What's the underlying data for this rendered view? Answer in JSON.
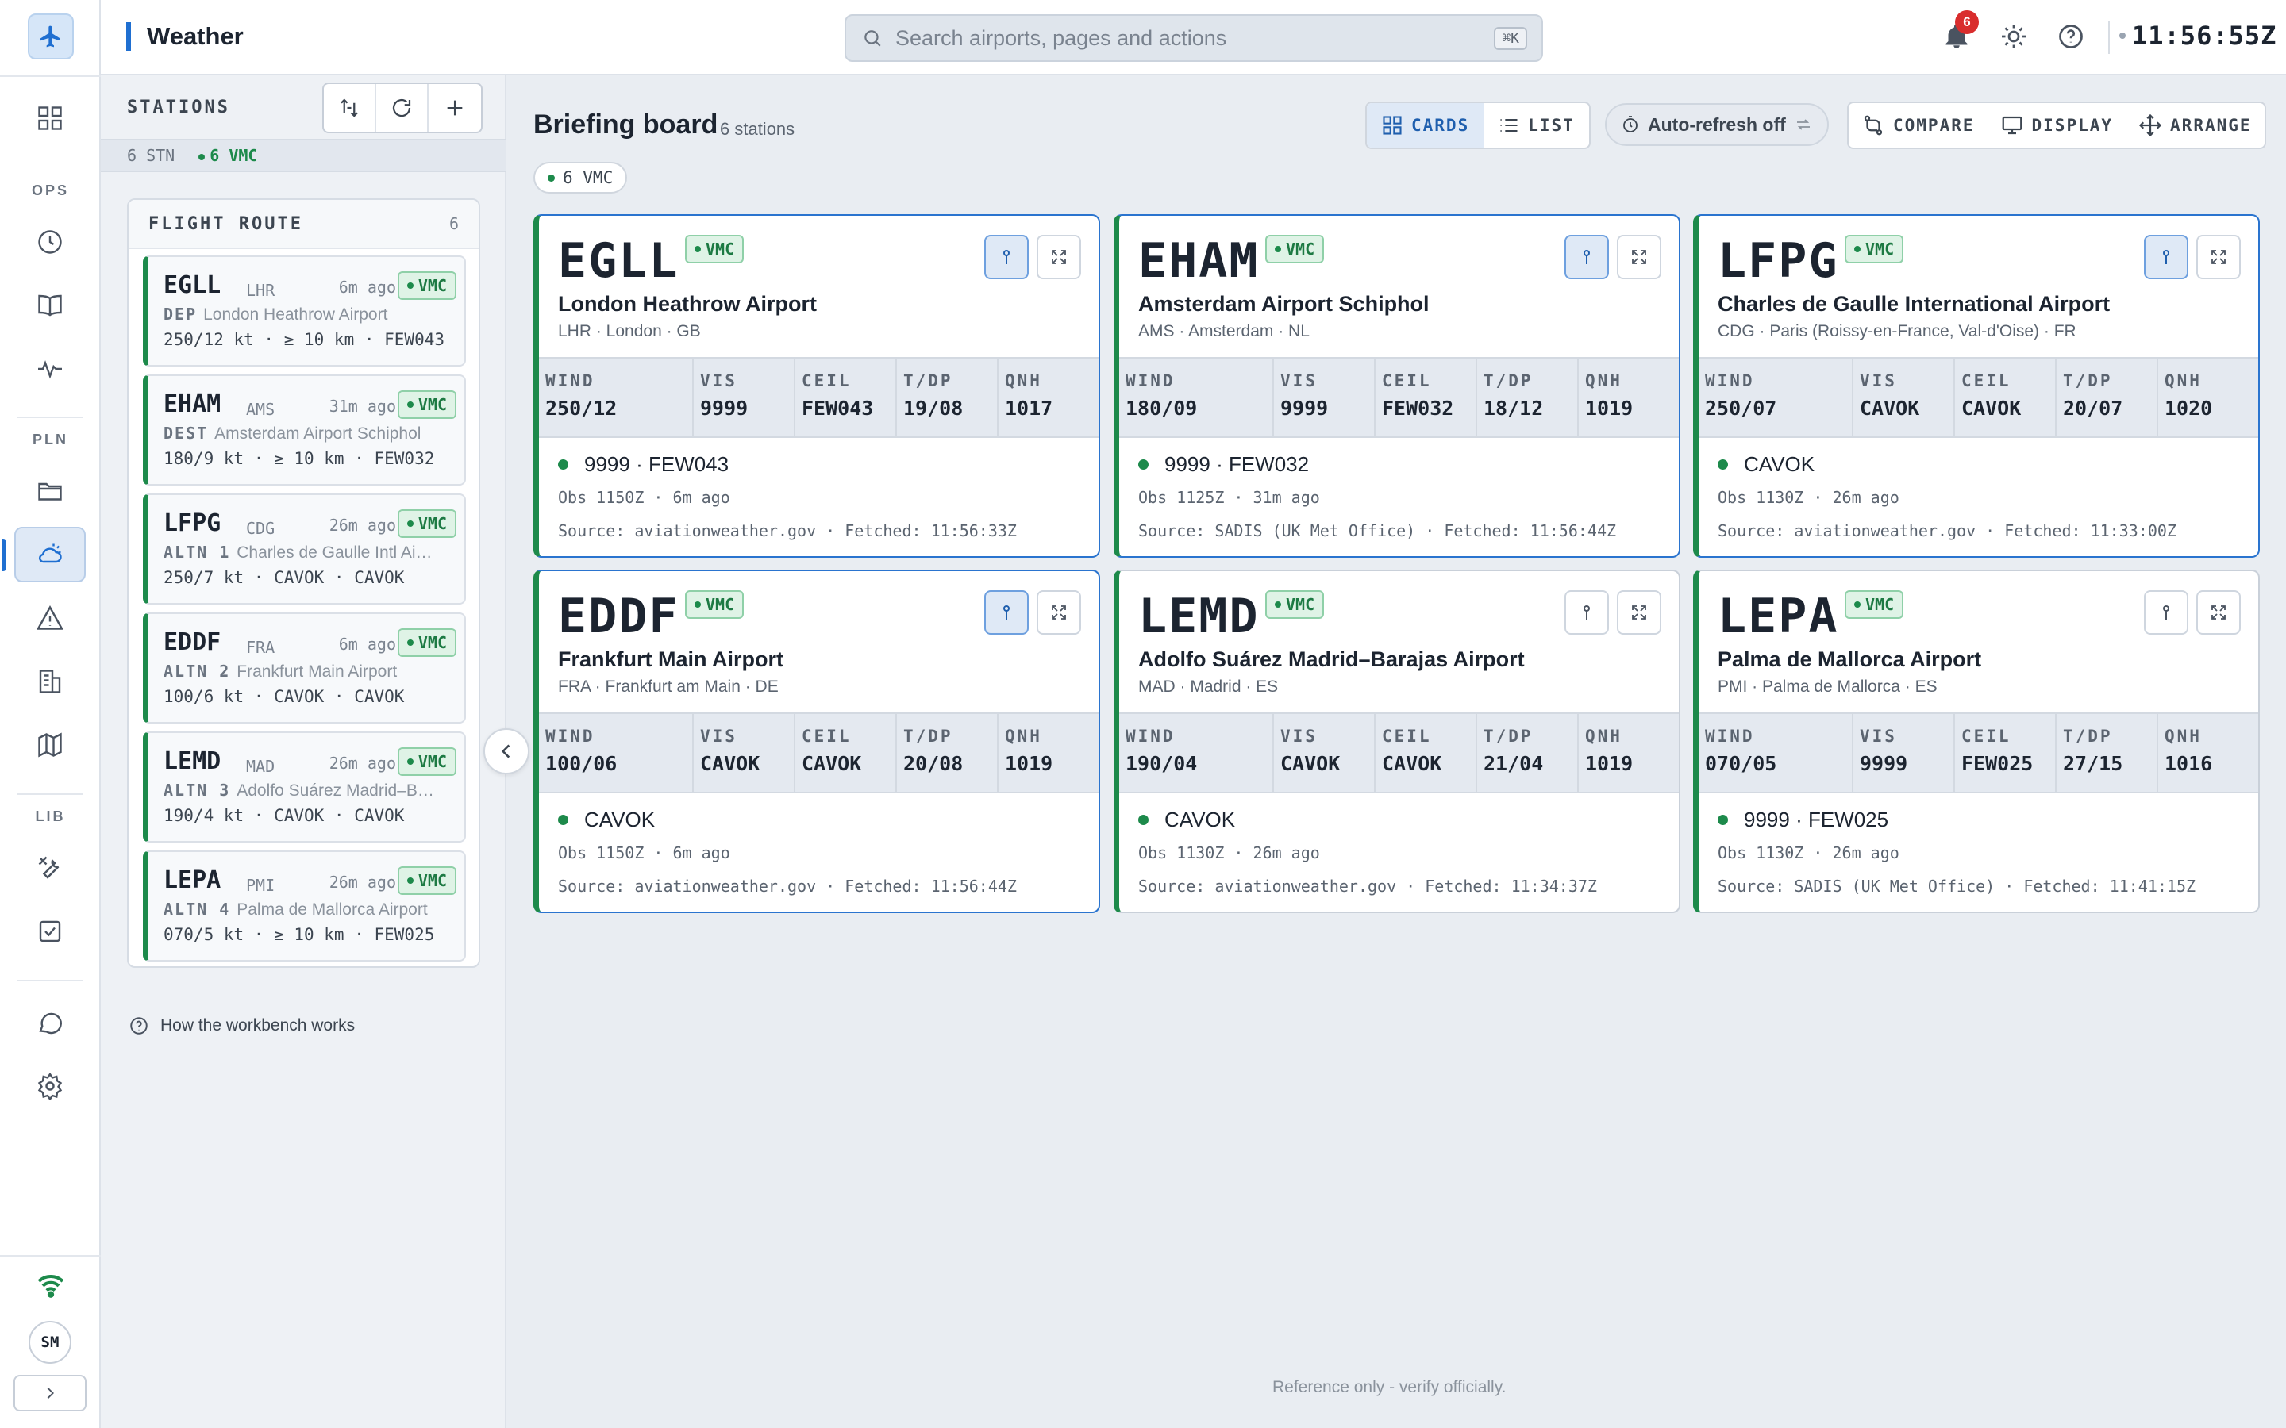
{
  "app": {
    "title": "Weather"
  },
  "search": {
    "placeholder": "Search airports, pages and actions",
    "shortcut": "⌘K"
  },
  "notifications": {
    "count": "6"
  },
  "clock": "11:56:55Z",
  "rail": {
    "sections": [
      "OPS",
      "PLN",
      "LIB"
    ],
    "items": [
      {
        "icon": "dashboard-icon"
      },
      {
        "icon": "clock-icon"
      },
      {
        "icon": "book-icon"
      },
      {
        "icon": "activity-icon"
      },
      {
        "icon": "folder-icon"
      },
      {
        "icon": "weather-icon"
      },
      {
        "icon": "warning-icon"
      },
      {
        "icon": "building-icon"
      },
      {
        "icon": "map-icon"
      },
      {
        "icon": "tools-icon"
      },
      {
        "icon": "checklist-icon"
      },
      {
        "icon": "chat-icon"
      },
      {
        "icon": "settings-icon"
      }
    ],
    "user_initials": "SM"
  },
  "stations_panel": {
    "title": "STATIONS",
    "stat_count": "6 STN",
    "stat_vmc": "6 VMC",
    "route_title": "FLIGHT ROUTE",
    "route_count": "6",
    "items": [
      {
        "icao": "EGLL",
        "iata": "LHR",
        "ago": "6m ago",
        "badge": "VMC",
        "role": "DEP",
        "name": "London Heathrow Airport",
        "wx": "250/12 kt · ≥ 10 km · FEW043"
      },
      {
        "icao": "EHAM",
        "iata": "AMS",
        "ago": "31m ago",
        "badge": "VMC",
        "role": "DEST",
        "name": "Amsterdam Airport Schiphol",
        "wx": "180/9 kt · ≥ 10 km · FEW032"
      },
      {
        "icao": "LFPG",
        "iata": "CDG",
        "ago": "26m ago",
        "badge": "VMC",
        "role": "ALTN 1",
        "name": "Charles de Gaulle Intl Ai…",
        "wx": "250/7 kt · CAVOK · CAVOK"
      },
      {
        "icao": "EDDF",
        "iata": "FRA",
        "ago": "6m ago",
        "badge": "VMC",
        "role": "ALTN 2",
        "name": "Frankfurt Main Airport",
        "wx": "100/6 kt · CAVOK · CAVOK"
      },
      {
        "icao": "LEMD",
        "iata": "MAD",
        "ago": "26m ago",
        "badge": "VMC",
        "role": "ALTN 3",
        "name": "Adolfo Suárez Madrid–B…",
        "wx": "190/4 kt · CAVOK · CAVOK"
      },
      {
        "icao": "LEPA",
        "iata": "PMI",
        "ago": "26m ago",
        "badge": "VMC",
        "role": "ALTN 4",
        "name": "Palma de Mallorca Airport",
        "wx": "070/5 kt · ≥ 10 km · FEW025"
      }
    ],
    "help_link": "How the workbench works"
  },
  "main": {
    "title": "Briefing board",
    "subtitle": "6 stations",
    "chip": "6 VMC",
    "view_cards": "CARDS",
    "view_list": "LIST",
    "auto_refresh": "Auto-refresh off",
    "compare": "COMPARE",
    "display": "DISPLAY",
    "arrange": "ARRANGE",
    "labels": {
      "wind": "WIND",
      "vis": "VIS",
      "ceil": "CEIL",
      "tdp": "T/DP",
      "qnh": "QNH"
    },
    "footer": "Reference only - verify officially."
  },
  "cards": [
    {
      "icao": "EGLL",
      "badge": "VMC",
      "name": "London Heathrow Airport",
      "sub": "LHR · London · GB",
      "wind": "250/12",
      "vis": "9999",
      "ceil": "FEW043",
      "tdp": "19/08",
      "qnh": "1017",
      "wx": "9999 · FEW043",
      "obs": "Obs 1150Z · 6m ago",
      "src": "Source: aviationweather.gov · Fetched: 11:56:33Z",
      "pinned": true
    },
    {
      "icao": "EHAM",
      "badge": "VMC",
      "name": "Amsterdam Airport Schiphol",
      "sub": "AMS · Amsterdam · NL",
      "wind": "180/09",
      "vis": "9999",
      "ceil": "FEW032",
      "tdp": "18/12",
      "qnh": "1019",
      "wx": "9999 · FEW032",
      "obs": "Obs 1125Z · 31m ago",
      "src": "Source: SADIS (UK Met Office) · Fetched: 11:56:44Z",
      "pinned": true
    },
    {
      "icao": "LFPG",
      "badge": "VMC",
      "name": "Charles de Gaulle International Airport",
      "sub": "CDG · Paris (Roissy-en-France, Val-d'Oise) · FR",
      "wind": "250/07",
      "vis": "CAVOK",
      "ceil": "CAVOK",
      "tdp": "20/07",
      "qnh": "1020",
      "wx": "CAVOK",
      "obs": "Obs 1130Z · 26m ago",
      "src": "Source: aviationweather.gov · Fetched: 11:33:00Z",
      "pinned": true
    },
    {
      "icao": "EDDF",
      "badge": "VMC",
      "name": "Frankfurt Main Airport",
      "sub": "FRA · Frankfurt am Main · DE",
      "wind": "100/06",
      "vis": "CAVOK",
      "ceil": "CAVOK",
      "tdp": "20/08",
      "qnh": "1019",
      "wx": "CAVOK",
      "obs": "Obs 1150Z · 6m ago",
      "src": "Source: aviationweather.gov · Fetched: 11:56:44Z",
      "pinned": true
    },
    {
      "icao": "LEMD",
      "badge": "VMC",
      "name": "Adolfo Suárez Madrid–Barajas Airport",
      "sub": "MAD · Madrid · ES",
      "wind": "190/04",
      "vis": "CAVOK",
      "ceil": "CAVOK",
      "tdp": "21/04",
      "qnh": "1019",
      "wx": "CAVOK",
      "obs": "Obs 1130Z · 26m ago",
      "src": "Source: aviationweather.gov · Fetched: 11:34:37Z",
      "pinned": false
    },
    {
      "icao": "LEPA",
      "badge": "VMC",
      "name": "Palma de Mallorca Airport",
      "sub": "PMI · Palma de Mallorca · ES",
      "wind": "070/05",
      "vis": "9999",
      "ceil": "FEW025",
      "tdp": "27/15",
      "qnh": "1016",
      "wx": "9999 · FEW025",
      "obs": "Obs 1130Z · 26m ago",
      "src": "Source: SADIS (UK Met Office) · Fetched: 11:41:15Z",
      "pinned": false
    }
  ],
  "colors": {
    "accent": "#1f6fd1",
    "vmc": "#1d8a4b",
    "alert": "#d92d2d"
  }
}
